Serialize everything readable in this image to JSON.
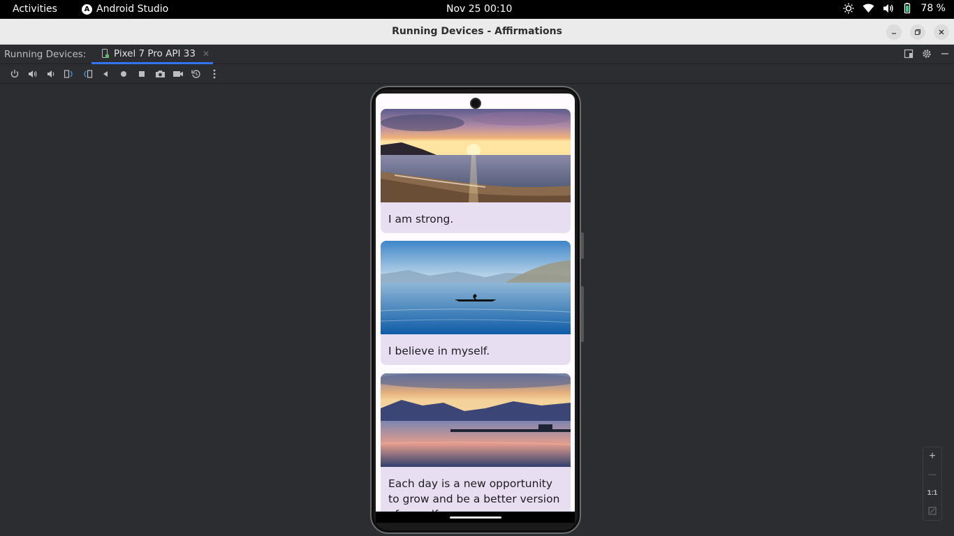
{
  "topbar": {
    "activities": "Activities",
    "app_name": "Android Studio",
    "clock": "Nov 25  00:10",
    "battery": "78 %"
  },
  "window": {
    "title": "Running Devices - Affirmations"
  },
  "tool_window": {
    "label": "Running Devices:",
    "tab_label": "Pixel 7 Pro API 33"
  },
  "toolbar": {
    "icons": [
      "power-icon",
      "volume-up-icon",
      "volume-down-icon",
      "rotate-left-icon",
      "rotate-right-icon",
      "back-icon",
      "home-icon",
      "overview-icon",
      "screenshot-icon",
      "screen-record-icon",
      "reset-icon",
      "more-icon"
    ]
  },
  "device": {
    "cards": [
      {
        "text": "I am strong."
      },
      {
        "text": "I believe in myself."
      },
      {
        "text": "Each day is a new opportunity to grow and be a better version of myself."
      }
    ]
  },
  "zoom": {
    "zoom_in": "+",
    "zoom_out": "—",
    "actual_size": "1:1"
  },
  "colors": {
    "accent": "#3574f0",
    "card_bg": "#e8def1",
    "ide_bg": "#2b2d30"
  }
}
